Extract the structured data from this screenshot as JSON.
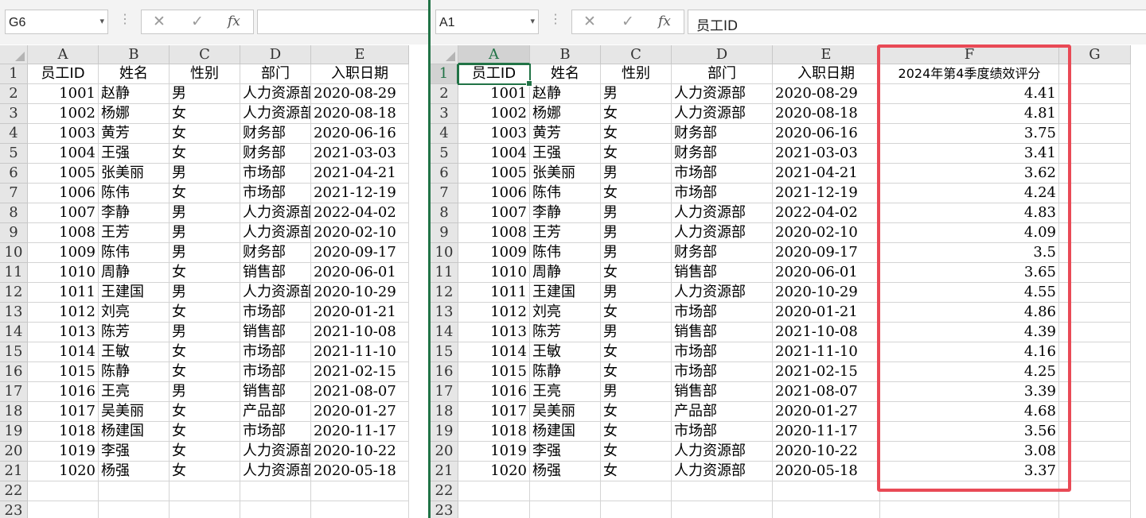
{
  "left": {
    "name_box": "G6",
    "formula": "",
    "columns": [
      "A",
      "B",
      "C",
      "D",
      "E"
    ],
    "headers": [
      "员工ID",
      "姓名",
      "性别",
      "部门",
      "入职日期"
    ]
  },
  "right": {
    "name_box": "A1",
    "formula": "员工ID",
    "columns": [
      "A",
      "B",
      "C",
      "D",
      "E",
      "F",
      "G"
    ],
    "headers": [
      "员工ID",
      "姓名",
      "性别",
      "部门",
      "入职日期",
      "2024年第4季度绩效评分"
    ]
  },
  "row_numbers": [
    "1",
    "2",
    "3",
    "4",
    "5",
    "6",
    "7",
    "8",
    "9",
    "10",
    "11",
    "12",
    "13",
    "14",
    "15",
    "16",
    "17",
    "18",
    "19",
    "20",
    "21",
    "22",
    "23"
  ],
  "rows": [
    [
      "1001",
      "赵静",
      "男",
      "人力资源部",
      "2020-08-29",
      "4.41"
    ],
    [
      "1002",
      "杨娜",
      "女",
      "人力资源部",
      "2020-08-18",
      "4.81"
    ],
    [
      "1003",
      "黄芳",
      "女",
      "财务部",
      "2020-06-16",
      "3.75"
    ],
    [
      "1004",
      "王强",
      "女",
      "财务部",
      "2021-03-03",
      "3.41"
    ],
    [
      "1005",
      "张美丽",
      "男",
      "市场部",
      "2021-04-21",
      "3.62"
    ],
    [
      "1006",
      "陈伟",
      "女",
      "市场部",
      "2021-12-19",
      "4.24"
    ],
    [
      "1007",
      "李静",
      "男",
      "人力资源部",
      "2022-04-02",
      "4.83"
    ],
    [
      "1008",
      "王芳",
      "男",
      "人力资源部",
      "2020-02-10",
      "4.09"
    ],
    [
      "1009",
      "陈伟",
      "男",
      "财务部",
      "2020-09-17",
      "3.5"
    ],
    [
      "1010",
      "周静",
      "女",
      "销售部",
      "2020-06-01",
      "3.65"
    ],
    [
      "1011",
      "王建国",
      "男",
      "人力资源部",
      "2020-10-29",
      "4.55"
    ],
    [
      "1012",
      "刘亮",
      "女",
      "市场部",
      "2020-01-21",
      "4.86"
    ],
    [
      "1013",
      "陈芳",
      "男",
      "销售部",
      "2021-10-08",
      "4.39"
    ],
    [
      "1014",
      "王敏",
      "女",
      "市场部",
      "2021-11-10",
      "4.16"
    ],
    [
      "1015",
      "陈静",
      "女",
      "市场部",
      "2021-02-15",
      "4.25"
    ],
    [
      "1016",
      "王亮",
      "男",
      "销售部",
      "2021-08-07",
      "3.39"
    ],
    [
      "1017",
      "吴美丽",
      "女",
      "产品部",
      "2020-01-27",
      "4.68"
    ],
    [
      "1018",
      "杨建国",
      "女",
      "市场部",
      "2020-11-17",
      "3.56"
    ],
    [
      "1019",
      "李强",
      "女",
      "人力资源部",
      "2020-10-22",
      "3.08"
    ],
    [
      "1020",
      "杨强",
      "女",
      "人力资源部",
      "2020-05-18",
      "3.37"
    ]
  ],
  "colors": {
    "accent": "#217346",
    "highlight": "#e94a56"
  }
}
